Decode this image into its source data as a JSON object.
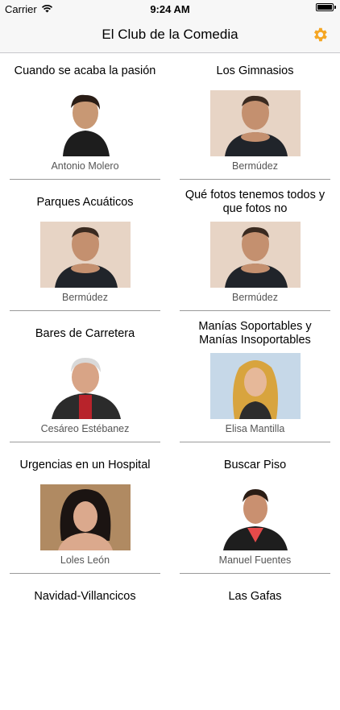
{
  "status_bar": {
    "carrier": "Carrier",
    "time": "9:24 AM",
    "battery_level": 1.0
  },
  "nav": {
    "title": "El Club de la Comedia",
    "settings_icon": "gear-icon",
    "accent": "#f5a623"
  },
  "items": [
    {
      "title": "Cuando se acaba la pasión",
      "comedian": "Antonio Molero",
      "photo": "antonio-molero-photo"
    },
    {
      "title": "Los Gimnasios",
      "comedian": "Bermúdez",
      "photo": "bermudez-photo"
    },
    {
      "title": "Parques Acuáticos",
      "comedian": "Bermúdez",
      "photo": "bermudez-photo"
    },
    {
      "title": "Qué fotos tenemos todos y que fotos no",
      "comedian": "Bermúdez",
      "photo": "bermudez-photo"
    },
    {
      "title": "Bares de Carretera",
      "comedian": "Cesáreo Estébanez",
      "photo": "cesareo-estebanez-photo"
    },
    {
      "title": "Manías Soportables y Manías Insoportables",
      "comedian": "Elisa Mantilla",
      "photo": "elisa-mantilla-photo"
    },
    {
      "title": "Urgencias en un Hospital",
      "comedian": "Loles León",
      "photo": "loles-leon-photo"
    },
    {
      "title": "Buscar Piso",
      "comedian": "Manuel Fuentes",
      "photo": "manuel-fuentes-photo"
    },
    {
      "title": "Navidad-Villancicos",
      "comedian": "",
      "photo": ""
    },
    {
      "title": "Las Gafas",
      "comedian": "",
      "photo": ""
    }
  ]
}
